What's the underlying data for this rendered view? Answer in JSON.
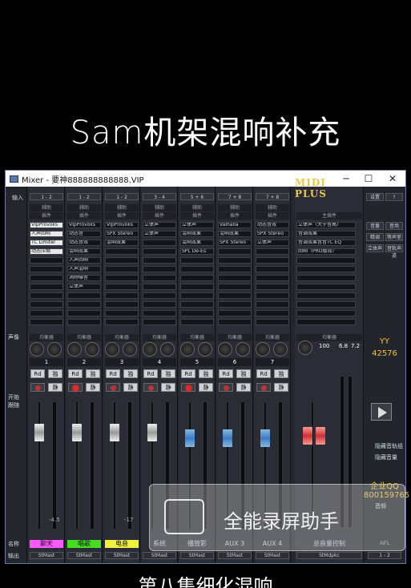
{
  "overlay": {
    "top_caption": "Sam机架混响补充",
    "bottom_caption": "第八集细化混响",
    "watermark": "全能录屏助手"
  },
  "window": {
    "title": "Mixer - 要神888888888888.VIP",
    "minimize": "─",
    "maximize": "☐",
    "close": "✕"
  },
  "brand": {
    "logo": "MIDI PLUS",
    "settings": "设置",
    "help": "?"
  },
  "left_labels": {
    "input": "输入",
    "vol": "声像",
    "start": "开始",
    "follow": "跟随",
    "name": "名称",
    "output": "输出"
  },
  "channels": [
    {
      "num": "1",
      "input": "1 - 2",
      "plugins": [
        "VIpProvoks",
        "人声回响",
        "TC Limiter",
        "动态压缩"
      ],
      "name": "聊天",
      "name_color": "#ff59ff",
      "out": "StMast",
      "db": "-4.5",
      "fader": "w",
      "rec_on": false
    },
    {
      "num": "2",
      "input": "1 - 2",
      "plugins": [
        "VIpProvoks",
        "动态音",
        "动态音效",
        "混响效果",
        "人声回响",
        "人声混响",
        "消除噪音",
        "立体声"
      ],
      "name": "唱歌",
      "name_color": "#44dd22",
      "out": "StMast",
      "db": "",
      "fader": "w",
      "rec_on": true
    },
    {
      "num": "3",
      "input": "1 - 2",
      "plugins": [
        "VIpProvoks",
        "SPX Stereo",
        "混响效果"
      ],
      "name": "电音",
      "name_color": "#f0f040",
      "out": "StMast",
      "db": "-17",
      "fader": "w",
      "rec_on": false
    },
    {
      "num": "4",
      "input": "3 - 4",
      "plugins": [
        "立体声",
        "立体声"
      ],
      "name": "系统",
      "name_color": "#2b2e35",
      "out": "StMast",
      "db": "",
      "fader": "w",
      "rec_on": false
    },
    {
      "num": "5",
      "input": "5 + 6",
      "plugins": [
        "立体声",
        "混响效果",
        "混响效果",
        "SPL De-Es"
      ],
      "name": "播放影",
      "name_color": "#2b2e35",
      "out": "StMast",
      "db": "",
      "fader": "b",
      "rec_on": true
    },
    {
      "num": "6",
      "input": "7 + 8",
      "plugins": [
        "Valhalla",
        "混响效果",
        "SPX Stereo"
      ],
      "name": "AUX 3",
      "name_color": "#2b2e35",
      "out": "StMast",
      "db": "",
      "fader": "b",
      "rec_on": false
    },
    {
      "num": "7",
      "input": "7 + 8",
      "plugins": [
        "动态音效",
        "SPX Stereo",
        "立体声"
      ],
      "name": "AUX 4",
      "name_color": "#2b2e35",
      "out": "StMast",
      "db": "",
      "fader": "b",
      "rec_on": false
    }
  ],
  "master": {
    "title": "主插件",
    "plugins": [
      "立体声（大于音高）",
      "音调效果",
      "音调效果音音TC EQ",
      "回响（PRO版效）"
    ],
    "name": "总音量控制",
    "out": "StMdpkc",
    "vol": "100",
    "lvl": "6.8",
    "lvl2": "7.2"
  },
  "right_panel": {
    "btn1": "音量",
    "btn2": "音场",
    "btn3": "精调",
    "btn4": "等声室",
    "btn5": "立体声",
    "btn6": "音轨声道",
    "yy": "YY",
    "yy_num": "42576",
    "qq": "企业QQ",
    "qq_num": "800159765",
    "opt1": "隐藏音轨组",
    "opt2": "隐藏音量",
    "pager": "音频",
    "afl": "AFL",
    "in": "1 - 2"
  },
  "labels": {
    "aux": "辅助",
    "plugin": "插件",
    "eq": "均衡器",
    "rd": "Rd",
    "solo": "独",
    "mute": "静"
  }
}
